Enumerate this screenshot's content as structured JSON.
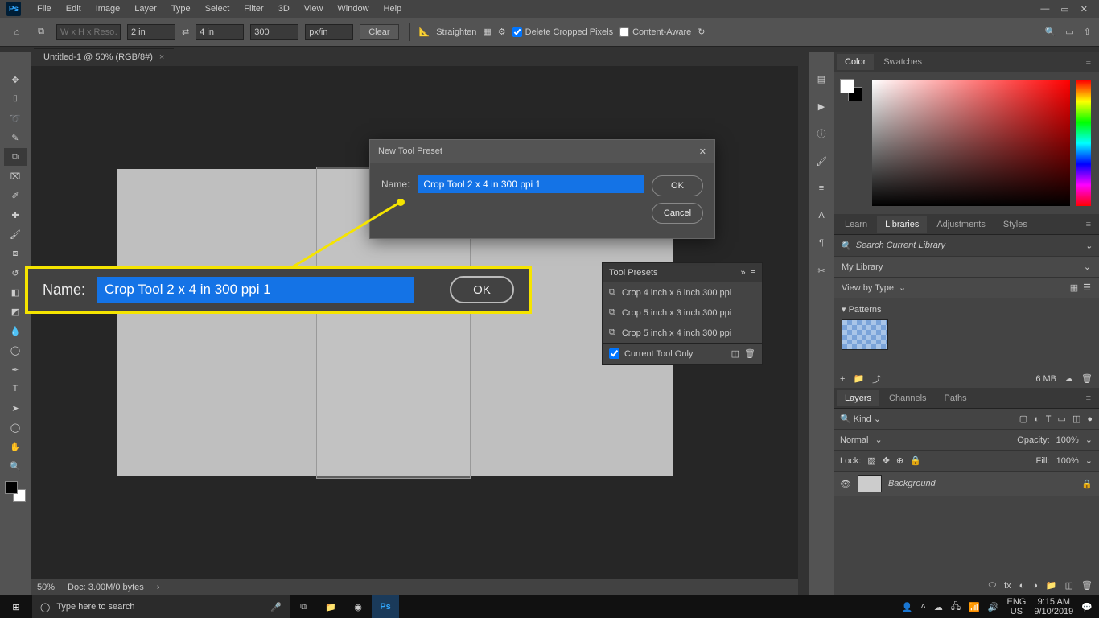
{
  "menu": {
    "items": [
      "File",
      "Edit",
      "Image",
      "Layer",
      "Type",
      "Select",
      "Filter",
      "3D",
      "View",
      "Window",
      "Help"
    ]
  },
  "options": {
    "wxh_placeholder": "W x H x Reso…",
    "w": "2 in",
    "h": "4 in",
    "res": "300",
    "unit": "px/in",
    "clear": "Clear",
    "straighten": "Straighten",
    "delete_cropped": "Delete Cropped Pixels",
    "content_aware": "Content-Aware"
  },
  "tab": {
    "title": "Untitled-1 @ 50% (RGB/8#)"
  },
  "dialog": {
    "title": "New Tool Preset",
    "name_label": "Name:",
    "name_value": "Crop Tool 2 x 4 in 300 ppi 1",
    "ok": "OK",
    "cancel": "Cancel"
  },
  "callout": {
    "name_label": "Name:",
    "name_value": "Crop Tool 2 x 4 in 300 ppi 1",
    "ok": "OK"
  },
  "tool_presets": {
    "title": "Tool Presets",
    "items": [
      "Crop 4 inch x 6 inch 300 ppi",
      "Crop 5 inch x 3 inch 300 ppi",
      "Crop 5 inch x 4 inch 300 ppi"
    ],
    "current_only": "Current Tool Only"
  },
  "panels": {
    "color_tabs": [
      "Color",
      "Swatches"
    ],
    "lib_tabs": [
      "Learn",
      "Libraries",
      "Adjustments",
      "Styles"
    ],
    "lib_search": "Search Current Library",
    "my_library": "My Library",
    "view_by": "View by Type",
    "patterns": "Patterns",
    "size": "6 MB",
    "layer_tabs": [
      "Layers",
      "Channels",
      "Paths"
    ],
    "kind": "Kind",
    "blend": "Normal",
    "opacity_l": "Opacity:",
    "opacity_v": "100%",
    "lock": "Lock:",
    "fill_l": "Fill:",
    "fill_v": "100%",
    "bg_layer": "Background"
  },
  "status": {
    "zoom": "50%",
    "doc": "Doc: 3.00M/0 bytes"
  },
  "taskbar": {
    "search_placeholder": "Type here to search",
    "lang1": "ENG",
    "lang2": "US",
    "time": "9:15 AM",
    "date": "9/10/2019"
  }
}
